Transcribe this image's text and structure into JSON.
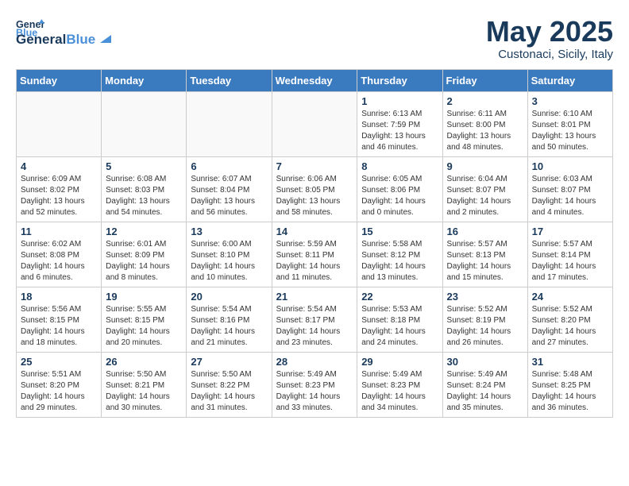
{
  "header": {
    "logo": {
      "general": "General",
      "blue": "Blue"
    },
    "month": "May 2025",
    "location": "Custonaci, Sicily, Italy"
  },
  "weekdays": [
    "Sunday",
    "Monday",
    "Tuesday",
    "Wednesday",
    "Thursday",
    "Friday",
    "Saturday"
  ],
  "weeks": [
    [
      {
        "day": "",
        "info": ""
      },
      {
        "day": "",
        "info": ""
      },
      {
        "day": "",
        "info": ""
      },
      {
        "day": "",
        "info": ""
      },
      {
        "day": "1",
        "info": "Sunrise: 6:13 AM\nSunset: 7:59 PM\nDaylight: 13 hours\nand 46 minutes."
      },
      {
        "day": "2",
        "info": "Sunrise: 6:11 AM\nSunset: 8:00 PM\nDaylight: 13 hours\nand 48 minutes."
      },
      {
        "day": "3",
        "info": "Sunrise: 6:10 AM\nSunset: 8:01 PM\nDaylight: 13 hours\nand 50 minutes."
      }
    ],
    [
      {
        "day": "4",
        "info": "Sunrise: 6:09 AM\nSunset: 8:02 PM\nDaylight: 13 hours\nand 52 minutes."
      },
      {
        "day": "5",
        "info": "Sunrise: 6:08 AM\nSunset: 8:03 PM\nDaylight: 13 hours\nand 54 minutes."
      },
      {
        "day": "6",
        "info": "Sunrise: 6:07 AM\nSunset: 8:04 PM\nDaylight: 13 hours\nand 56 minutes."
      },
      {
        "day": "7",
        "info": "Sunrise: 6:06 AM\nSunset: 8:05 PM\nDaylight: 13 hours\nand 58 minutes."
      },
      {
        "day": "8",
        "info": "Sunrise: 6:05 AM\nSunset: 8:06 PM\nDaylight: 14 hours\nand 0 minutes."
      },
      {
        "day": "9",
        "info": "Sunrise: 6:04 AM\nSunset: 8:07 PM\nDaylight: 14 hours\nand 2 minutes."
      },
      {
        "day": "10",
        "info": "Sunrise: 6:03 AM\nSunset: 8:07 PM\nDaylight: 14 hours\nand 4 minutes."
      }
    ],
    [
      {
        "day": "11",
        "info": "Sunrise: 6:02 AM\nSunset: 8:08 PM\nDaylight: 14 hours\nand 6 minutes."
      },
      {
        "day": "12",
        "info": "Sunrise: 6:01 AM\nSunset: 8:09 PM\nDaylight: 14 hours\nand 8 minutes."
      },
      {
        "day": "13",
        "info": "Sunrise: 6:00 AM\nSunset: 8:10 PM\nDaylight: 14 hours\nand 10 minutes."
      },
      {
        "day": "14",
        "info": "Sunrise: 5:59 AM\nSunset: 8:11 PM\nDaylight: 14 hours\nand 11 minutes."
      },
      {
        "day": "15",
        "info": "Sunrise: 5:58 AM\nSunset: 8:12 PM\nDaylight: 14 hours\nand 13 minutes."
      },
      {
        "day": "16",
        "info": "Sunrise: 5:57 AM\nSunset: 8:13 PM\nDaylight: 14 hours\nand 15 minutes."
      },
      {
        "day": "17",
        "info": "Sunrise: 5:57 AM\nSunset: 8:14 PM\nDaylight: 14 hours\nand 17 minutes."
      }
    ],
    [
      {
        "day": "18",
        "info": "Sunrise: 5:56 AM\nSunset: 8:15 PM\nDaylight: 14 hours\nand 18 minutes."
      },
      {
        "day": "19",
        "info": "Sunrise: 5:55 AM\nSunset: 8:15 PM\nDaylight: 14 hours\nand 20 minutes."
      },
      {
        "day": "20",
        "info": "Sunrise: 5:54 AM\nSunset: 8:16 PM\nDaylight: 14 hours\nand 21 minutes."
      },
      {
        "day": "21",
        "info": "Sunrise: 5:54 AM\nSunset: 8:17 PM\nDaylight: 14 hours\nand 23 minutes."
      },
      {
        "day": "22",
        "info": "Sunrise: 5:53 AM\nSunset: 8:18 PM\nDaylight: 14 hours\nand 24 minutes."
      },
      {
        "day": "23",
        "info": "Sunrise: 5:52 AM\nSunset: 8:19 PM\nDaylight: 14 hours\nand 26 minutes."
      },
      {
        "day": "24",
        "info": "Sunrise: 5:52 AM\nSunset: 8:20 PM\nDaylight: 14 hours\nand 27 minutes."
      }
    ],
    [
      {
        "day": "25",
        "info": "Sunrise: 5:51 AM\nSunset: 8:20 PM\nDaylight: 14 hours\nand 29 minutes."
      },
      {
        "day": "26",
        "info": "Sunrise: 5:50 AM\nSunset: 8:21 PM\nDaylight: 14 hours\nand 30 minutes."
      },
      {
        "day": "27",
        "info": "Sunrise: 5:50 AM\nSunset: 8:22 PM\nDaylight: 14 hours\nand 31 minutes."
      },
      {
        "day": "28",
        "info": "Sunrise: 5:49 AM\nSunset: 8:23 PM\nDaylight: 14 hours\nand 33 minutes."
      },
      {
        "day": "29",
        "info": "Sunrise: 5:49 AM\nSunset: 8:23 PM\nDaylight: 14 hours\nand 34 minutes."
      },
      {
        "day": "30",
        "info": "Sunrise: 5:49 AM\nSunset: 8:24 PM\nDaylight: 14 hours\nand 35 minutes."
      },
      {
        "day": "31",
        "info": "Sunrise: 5:48 AM\nSunset: 8:25 PM\nDaylight: 14 hours\nand 36 minutes."
      }
    ]
  ]
}
